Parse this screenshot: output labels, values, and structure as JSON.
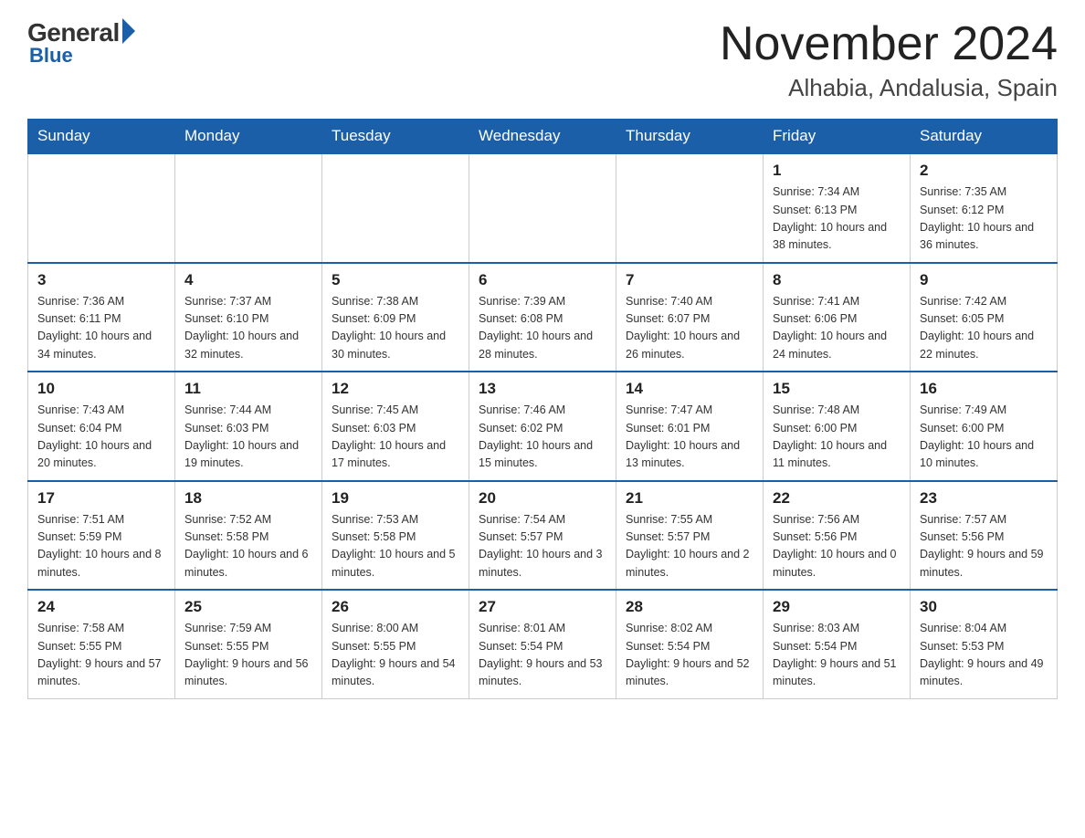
{
  "header": {
    "logo_general": "General",
    "logo_blue": "Blue",
    "month_title": "November 2024",
    "location": "Alhabia, Andalusia, Spain"
  },
  "days_of_week": [
    "Sunday",
    "Monday",
    "Tuesday",
    "Wednesday",
    "Thursday",
    "Friday",
    "Saturday"
  ],
  "weeks": [
    {
      "days": [
        {
          "number": "",
          "info": ""
        },
        {
          "number": "",
          "info": ""
        },
        {
          "number": "",
          "info": ""
        },
        {
          "number": "",
          "info": ""
        },
        {
          "number": "",
          "info": ""
        },
        {
          "number": "1",
          "info": "Sunrise: 7:34 AM\nSunset: 6:13 PM\nDaylight: 10 hours and 38 minutes."
        },
        {
          "number": "2",
          "info": "Sunrise: 7:35 AM\nSunset: 6:12 PM\nDaylight: 10 hours and 36 minutes."
        }
      ]
    },
    {
      "days": [
        {
          "number": "3",
          "info": "Sunrise: 7:36 AM\nSunset: 6:11 PM\nDaylight: 10 hours and 34 minutes."
        },
        {
          "number": "4",
          "info": "Sunrise: 7:37 AM\nSunset: 6:10 PM\nDaylight: 10 hours and 32 minutes."
        },
        {
          "number": "5",
          "info": "Sunrise: 7:38 AM\nSunset: 6:09 PM\nDaylight: 10 hours and 30 minutes."
        },
        {
          "number": "6",
          "info": "Sunrise: 7:39 AM\nSunset: 6:08 PM\nDaylight: 10 hours and 28 minutes."
        },
        {
          "number": "7",
          "info": "Sunrise: 7:40 AM\nSunset: 6:07 PM\nDaylight: 10 hours and 26 minutes."
        },
        {
          "number": "8",
          "info": "Sunrise: 7:41 AM\nSunset: 6:06 PM\nDaylight: 10 hours and 24 minutes."
        },
        {
          "number": "9",
          "info": "Sunrise: 7:42 AM\nSunset: 6:05 PM\nDaylight: 10 hours and 22 minutes."
        }
      ]
    },
    {
      "days": [
        {
          "number": "10",
          "info": "Sunrise: 7:43 AM\nSunset: 6:04 PM\nDaylight: 10 hours and 20 minutes."
        },
        {
          "number": "11",
          "info": "Sunrise: 7:44 AM\nSunset: 6:03 PM\nDaylight: 10 hours and 19 minutes."
        },
        {
          "number": "12",
          "info": "Sunrise: 7:45 AM\nSunset: 6:03 PM\nDaylight: 10 hours and 17 minutes."
        },
        {
          "number": "13",
          "info": "Sunrise: 7:46 AM\nSunset: 6:02 PM\nDaylight: 10 hours and 15 minutes."
        },
        {
          "number": "14",
          "info": "Sunrise: 7:47 AM\nSunset: 6:01 PM\nDaylight: 10 hours and 13 minutes."
        },
        {
          "number": "15",
          "info": "Sunrise: 7:48 AM\nSunset: 6:00 PM\nDaylight: 10 hours and 11 minutes."
        },
        {
          "number": "16",
          "info": "Sunrise: 7:49 AM\nSunset: 6:00 PM\nDaylight: 10 hours and 10 minutes."
        }
      ]
    },
    {
      "days": [
        {
          "number": "17",
          "info": "Sunrise: 7:51 AM\nSunset: 5:59 PM\nDaylight: 10 hours and 8 minutes."
        },
        {
          "number": "18",
          "info": "Sunrise: 7:52 AM\nSunset: 5:58 PM\nDaylight: 10 hours and 6 minutes."
        },
        {
          "number": "19",
          "info": "Sunrise: 7:53 AM\nSunset: 5:58 PM\nDaylight: 10 hours and 5 minutes."
        },
        {
          "number": "20",
          "info": "Sunrise: 7:54 AM\nSunset: 5:57 PM\nDaylight: 10 hours and 3 minutes."
        },
        {
          "number": "21",
          "info": "Sunrise: 7:55 AM\nSunset: 5:57 PM\nDaylight: 10 hours and 2 minutes."
        },
        {
          "number": "22",
          "info": "Sunrise: 7:56 AM\nSunset: 5:56 PM\nDaylight: 10 hours and 0 minutes."
        },
        {
          "number": "23",
          "info": "Sunrise: 7:57 AM\nSunset: 5:56 PM\nDaylight: 9 hours and 59 minutes."
        }
      ]
    },
    {
      "days": [
        {
          "number": "24",
          "info": "Sunrise: 7:58 AM\nSunset: 5:55 PM\nDaylight: 9 hours and 57 minutes."
        },
        {
          "number": "25",
          "info": "Sunrise: 7:59 AM\nSunset: 5:55 PM\nDaylight: 9 hours and 56 minutes."
        },
        {
          "number": "26",
          "info": "Sunrise: 8:00 AM\nSunset: 5:55 PM\nDaylight: 9 hours and 54 minutes."
        },
        {
          "number": "27",
          "info": "Sunrise: 8:01 AM\nSunset: 5:54 PM\nDaylight: 9 hours and 53 minutes."
        },
        {
          "number": "28",
          "info": "Sunrise: 8:02 AM\nSunset: 5:54 PM\nDaylight: 9 hours and 52 minutes."
        },
        {
          "number": "29",
          "info": "Sunrise: 8:03 AM\nSunset: 5:54 PM\nDaylight: 9 hours and 51 minutes."
        },
        {
          "number": "30",
          "info": "Sunrise: 8:04 AM\nSunset: 5:53 PM\nDaylight: 9 hours and 49 minutes."
        }
      ]
    }
  ]
}
